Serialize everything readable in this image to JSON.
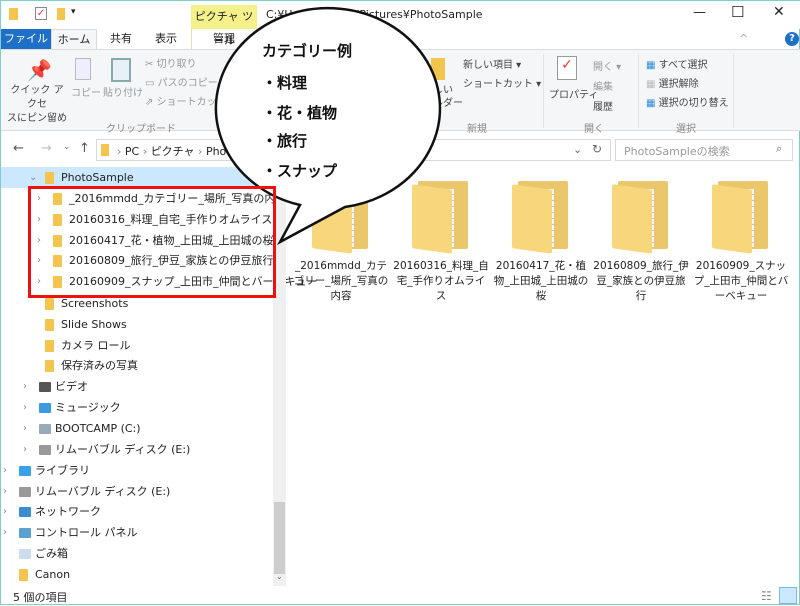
{
  "window": {
    "path": "C:¥Users¥mako¥Pictures¥PhotoSample",
    "contextual_tab": "ピクチャ ツール",
    "minimize": "—",
    "maximize": "☐",
    "close": "✕",
    "help": "?"
  },
  "tabs": [
    {
      "label": "ファイル",
      "active": true
    },
    {
      "label": "ホーム"
    },
    {
      "label": "共有"
    },
    {
      "label": "表示"
    },
    {
      "label": "管理"
    }
  ],
  "ribbon": {
    "clipboard": {
      "group": "クリップボード",
      "pin": "クイック アクセ\nスにピン留め",
      "copy": "コピー",
      "paste": "貼り付け",
      "cut": "切り取り",
      "copy_path": "パスのコピー",
      "paste_shortcut": "ショートカットの"
    },
    "new": {
      "group": "新規",
      "new_folder": "しい\nルダー",
      "new_item": "新しい項目 ▾",
      "shortcut": "ショートカット ▾"
    },
    "open": {
      "group": "開く",
      "properties": "プロパティ",
      "open": "開く ▾",
      "edit": "編集",
      "history": "履歴"
    },
    "select": {
      "group": "選択",
      "all": "すべて選択",
      "none": "選択解除",
      "invert": "選択の切り替え"
    }
  },
  "address": {
    "breadcrumb": [
      "PC",
      "ピクチャ",
      "Pho"
    ],
    "search_placeholder": "PhotoSampleの検索"
  },
  "nav": {
    "selected": "PhotoSample",
    "children": [
      "_2016mmdd_カテゴリー_場所_写真の内容",
      "20160316_料理_自宅_手作りオムライス",
      "20160417_花・植物_上田城_上田城の桜",
      "20160809_旅行_伊豆_家族との伊豆旅行",
      "20160909_スナップ_上田市_仲間とバーベキュー"
    ],
    "siblings": [
      "Screenshots",
      "Slide Shows",
      "カメラ ロール",
      "保存済みの写真"
    ],
    "others": [
      {
        "label": "ビデオ",
        "icon": "video-icon",
        "indent": 1
      },
      {
        "label": "ミュージック",
        "icon": "music-icon",
        "indent": 1
      },
      {
        "label": "BOOTCAMP (C:)",
        "icon": "drive-icon",
        "indent": 1
      },
      {
        "label": "リムーバブル ディスク (E:)",
        "icon": "removable-drive-icon",
        "indent": 1
      },
      {
        "label": "ライブラリ",
        "icon": "library-icon",
        "indent": 0
      },
      {
        "label": "リムーバブル ディスク (E:)",
        "icon": "removable-drive-icon",
        "indent": 0
      },
      {
        "label": "ネットワーク",
        "icon": "network-icon",
        "indent": 0
      },
      {
        "label": "コントロール パネル",
        "icon": "control-panel-icon",
        "indent": 0
      },
      {
        "label": "ごみ箱",
        "icon": "recycle-bin-icon",
        "indent": 0,
        "nochev": true
      },
      {
        "label": "Canon",
        "icon": "folder-icon",
        "indent": 0,
        "nochev": true
      }
    ]
  },
  "files": [
    "_2016mmdd_カテゴリー_場所_写真の内容",
    "20160316_料理_自宅_手作りオムライス",
    "20160417_花・植物_上田城_上田城の桜",
    "20160809_旅行_伊豆_家族との伊豆旅行",
    "20160909_スナップ_上田市_仲間とバーベキュー"
  ],
  "callout": {
    "title": "カテゴリー例",
    "items": [
      "・料理",
      "・花・植物",
      "・旅行",
      "・スナップ"
    ]
  },
  "status": {
    "count": "5 個の項目"
  },
  "colors": {
    "file_tab": "#1e6fc8",
    "contextual": "#f4f08a",
    "highlight": "#cce8ff",
    "annotation": "#ee1111"
  }
}
